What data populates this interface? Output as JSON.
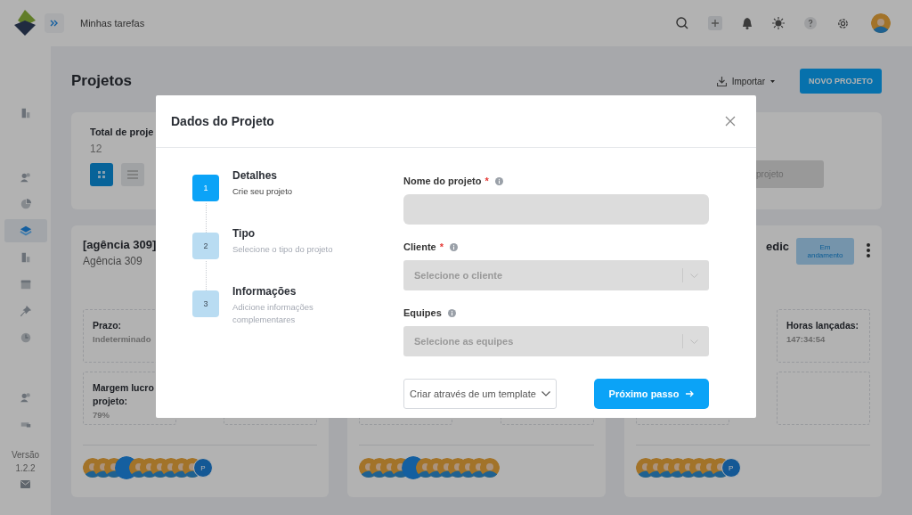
{
  "topbar": {
    "title": "Minhas tarefas"
  },
  "sidebar": {
    "items": [
      {
        "selected": false
      },
      {
        "selected": false
      },
      {
        "selected": false
      },
      {
        "selected": true
      },
      {
        "selected": false
      },
      {
        "selected": false
      },
      {
        "selected": false
      },
      {
        "selected": false
      }
    ],
    "bottom_items": [
      {
        "selected": false
      },
      {
        "selected": false
      }
    ],
    "version_label": "Versão",
    "version": "1.2.2"
  },
  "page": {
    "title": "Projetos",
    "import_label": "Importar",
    "new_button": "NOVO PROJETO"
  },
  "summary": {
    "title": "Total de proje",
    "count": "12",
    "views": [
      {
        "selected": true
      },
      {
        "selected": false
      }
    ],
    "action": "projeto"
  },
  "cards": [
    {
      "title": "[agência 309]",
      "subtitle": "Agência 309",
      "stats": [
        {
          "label_lines": [
            "Prazo:"
          ],
          "value": "Indeterminado"
        },
        {
          "label_lines": [
            "Margem lucro",
            "projeto:"
          ],
          "value": "79%"
        }
      ],
      "avatars": [
        {
          "kind": "photo"
        },
        {
          "kind": "photo"
        },
        {
          "kind": "photo"
        },
        {
          "kind": "blank"
        },
        {
          "kind": "photo"
        },
        {
          "kind": "photo"
        },
        {
          "kind": "photo"
        },
        {
          "kind": "photo"
        },
        {
          "kind": "photo"
        },
        {
          "kind": "photo"
        },
        {
          "kind": "initial",
          "text": "P"
        }
      ]
    },
    {
      "avatars": [
        {
          "kind": "photo"
        },
        {
          "kind": "photo"
        },
        {
          "kind": "photo"
        },
        {
          "kind": "photo"
        },
        {
          "kind": "blank"
        },
        {
          "kind": "photo"
        },
        {
          "kind": "photo"
        },
        {
          "kind": "photo"
        },
        {
          "kind": "photo"
        },
        {
          "kind": "photo"
        },
        {
          "kind": "photo"
        },
        {
          "kind": "photo"
        }
      ]
    },
    {
      "title": "edic",
      "status": "Em andamento",
      "stats": [
        {
          "label_lines": [
            "Horas lançadas:"
          ],
          "value": "147:34:54"
        }
      ],
      "avatars": [
        {
          "kind": "photo"
        },
        {
          "kind": "photo"
        },
        {
          "kind": "photo"
        },
        {
          "kind": "photo"
        },
        {
          "kind": "photo"
        },
        {
          "kind": "photo"
        },
        {
          "kind": "photo"
        },
        {
          "kind": "photo"
        },
        {
          "kind": "initial",
          "text": "P"
        }
      ]
    }
  ],
  "modal": {
    "title": "Dados do Projeto",
    "steps": [
      {
        "number": "1",
        "title": "Detalhes",
        "description": "Crie seu projeto",
        "selected": true
      },
      {
        "number": "2",
        "title": "Tipo",
        "description": "Selecione o tipo do projeto",
        "selected": false
      },
      {
        "number": "3",
        "title": "Informações",
        "description": "Adicione informações complementares",
        "selected": false
      }
    ],
    "fields": [
      {
        "kind": "text",
        "label": "Nome do projeto",
        "required_mark": "*"
      },
      {
        "kind": "select",
        "label": "Cliente",
        "required_mark": "*",
        "placeholder": "Selecione o cliente"
      },
      {
        "kind": "select",
        "label": "Equipes",
        "placeholder": "Selecione as equipes"
      }
    ],
    "template_button": "Criar através de um template",
    "next_button": "Próximo passo"
  }
}
